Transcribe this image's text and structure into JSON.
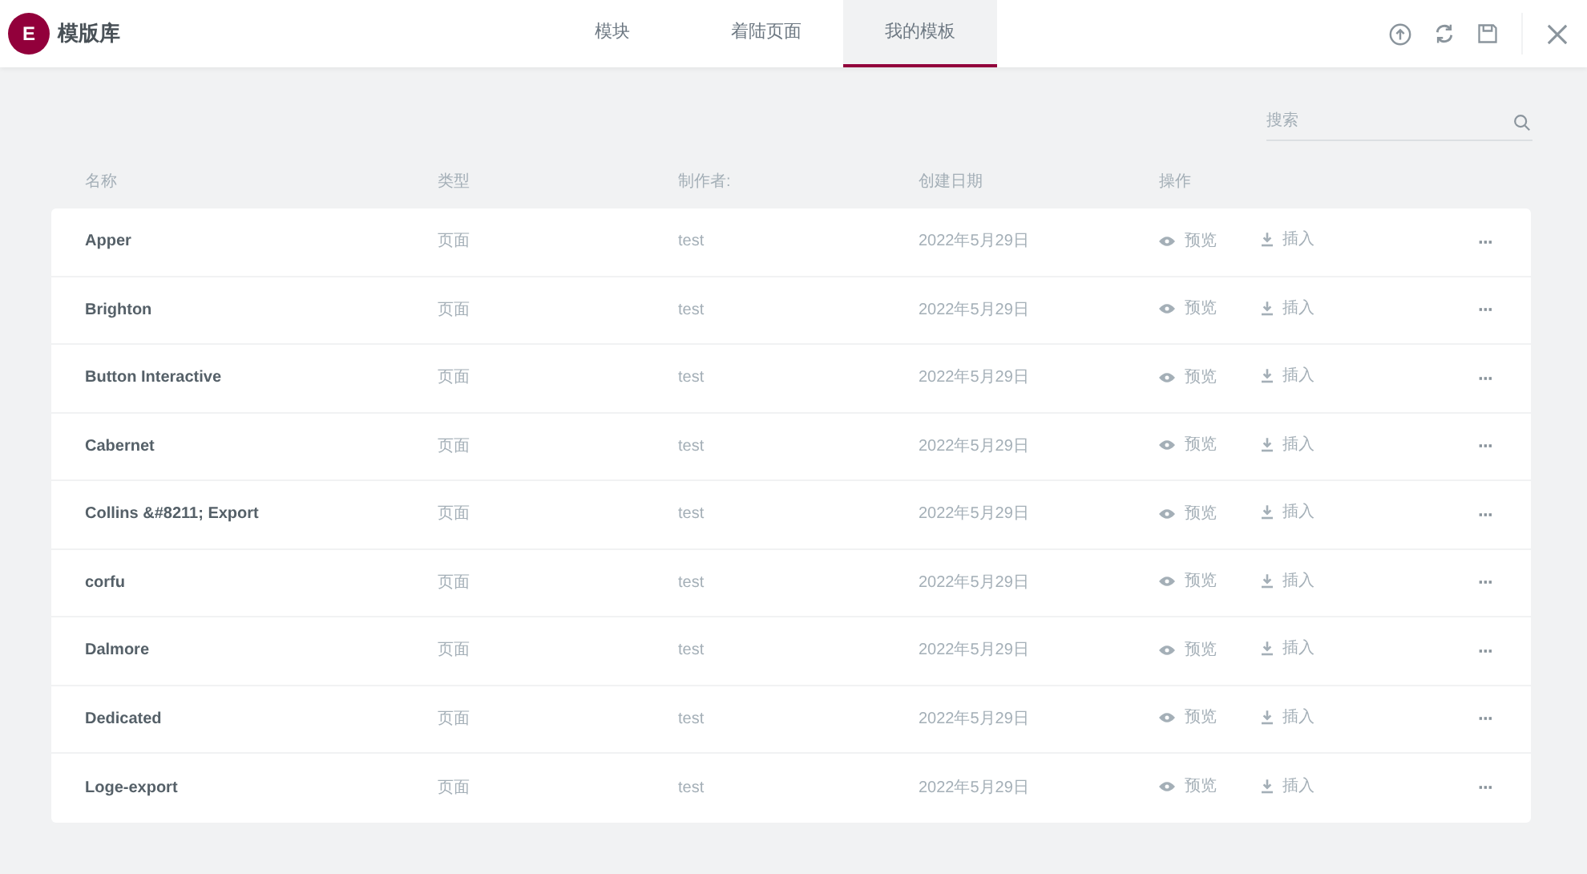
{
  "header": {
    "logo": "E",
    "title": "模版库",
    "tabs": [
      {
        "label": "模块",
        "selected": false
      },
      {
        "label": "着陆页面",
        "selected": false
      },
      {
        "label": "我的模板",
        "selected": true
      }
    ]
  },
  "search": {
    "placeholder": "搜索"
  },
  "table": {
    "columns": [
      "名称",
      "类型",
      "制作者:",
      "创建日期",
      "操作"
    ],
    "rows": [
      {
        "name": "Apper",
        "type": "页面",
        "author": "test",
        "date": "2022年5月29日",
        "preview": "预览",
        "insert": "插入",
        "more": "···"
      },
      {
        "name": "Brighton",
        "type": "页面",
        "author": "test",
        "date": "2022年5月29日",
        "preview": "预览",
        "insert": "插入",
        "more": "···"
      },
      {
        "name": "Button Interactive",
        "type": "页面",
        "author": "test",
        "date": "2022年5月29日",
        "preview": "预览",
        "insert": "插入",
        "more": "···"
      },
      {
        "name": "Cabernet",
        "type": "页面",
        "author": "test",
        "date": "2022年5月29日",
        "preview": "预览",
        "insert": "插入",
        "more": "···"
      },
      {
        "name": "Collins &#8211; Export",
        "type": "页面",
        "author": "test",
        "date": "2022年5月29日",
        "preview": "预览",
        "insert": "插入",
        "more": "···"
      },
      {
        "name": "corfu",
        "type": "页面",
        "author": "test",
        "date": "2022年5月29日",
        "preview": "预览",
        "insert": "插入",
        "more": "···"
      },
      {
        "name": "Dalmore",
        "type": "页面",
        "author": "test",
        "date": "2022年5月29日",
        "preview": "预览",
        "insert": "插入",
        "more": "···"
      },
      {
        "name": "Dedicated",
        "type": "页面",
        "author": "test",
        "date": "2022年5月29日",
        "preview": "预览",
        "insert": "插入",
        "more": "···"
      },
      {
        "name": "Loge-export",
        "type": "页面",
        "author": "test",
        "date": "2022年5月29日",
        "preview": "预览",
        "insert": "插入",
        "more": "···"
      }
    ]
  }
}
